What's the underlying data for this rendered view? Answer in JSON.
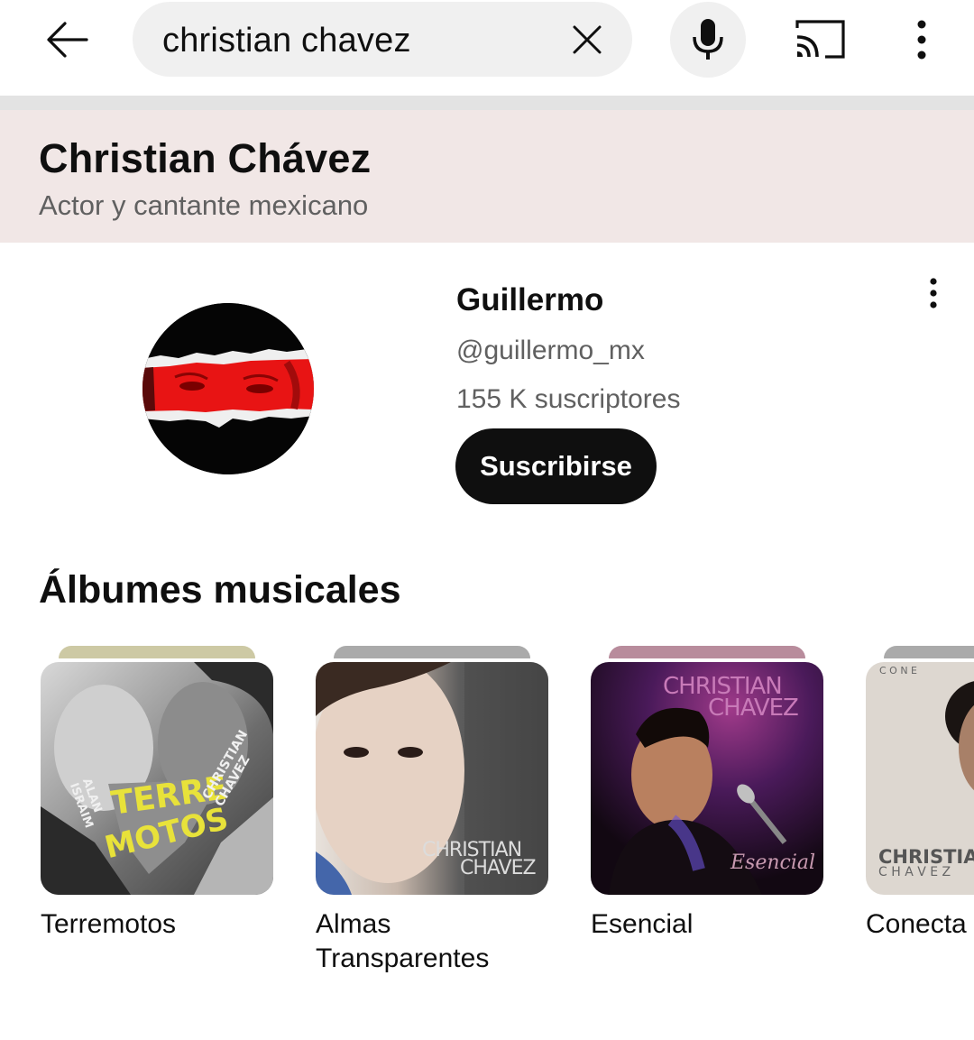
{
  "search": {
    "query": "christian chavez",
    "back_icon": "arrow-left-icon",
    "clear_icon": "close-icon",
    "mic_icon": "microphone-icon",
    "cast_icon": "cast-icon",
    "more_icon": "more-vertical-icon"
  },
  "knowledge_panel": {
    "title": "Christian Chávez",
    "subtitle": "Actor y cantante mexicano",
    "background": "#f1e7e6"
  },
  "channel": {
    "name": "Guillermo",
    "handle": "@guillermo_mx",
    "subscribers": "155 K suscriptores",
    "subscribe_label": "Suscribirse",
    "more_icon": "more-vertical-icon"
  },
  "albums": {
    "section_title": "Álbumes musicales",
    "items": [
      {
        "title": "Terremotos",
        "stack_color": "#cdc9a4",
        "cover_text_1": "TERRE",
        "cover_text_2": "MOTOS",
        "cover_text_3": "ALAN ISRAIM",
        "cover_text_4": "CHRISTIAN CHAVEZ"
      },
      {
        "title": "Almas Transparentes",
        "stack_color": "#aaaaaa",
        "cover_text_1": "CHRISTIAN",
        "cover_text_2": "CHAVEZ"
      },
      {
        "title": "Esencial",
        "stack_color": "#b88c9c",
        "cover_text_1": "CHRISTIAN",
        "cover_text_2": "CHAVEZ",
        "cover_text_3": "Esencial"
      },
      {
        "title": "Conecta",
        "stack_color": "#aaaaaa",
        "cover_text_1": "C O N E",
        "cover_text_2": "CHRISTIAN",
        "cover_text_3": "C H A V E Z"
      }
    ]
  }
}
